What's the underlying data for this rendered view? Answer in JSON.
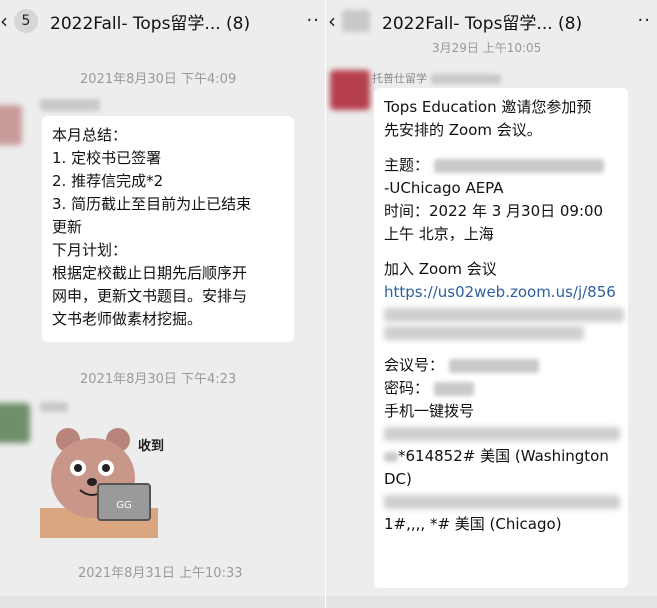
{
  "left": {
    "header": {
      "badge": "5",
      "title": "2022Fall-    Tops留学... (8)",
      "more": "··"
    },
    "messages": [
      {
        "timestamp": "2021年8月30日 下午4:09",
        "lines": [
          "本月总结：",
          "1. 定校书已签署",
          "2. 推荐信完成*2",
          "3. 简历截止至目前为止已结束",
          "更新",
          "下月计划：",
          "根据定校截止日期先后顺序开",
          "网申，更新文书题目。安排与",
          "文书老师做素材挖掘。"
        ]
      },
      {
        "timestamp": "2021年8月30日 下午4:23",
        "sticker_text": "收到"
      },
      {
        "timestamp": "2021年8月31日 上午10:33"
      }
    ]
  },
  "right": {
    "header": {
      "title": "2022Fall-    Tops留学... (8)",
      "more": "··"
    },
    "top_timestamp": "3月29日 上午10:05",
    "sender": "托普仕留学",
    "lines": {
      "l1": "Tops Education 邀请您参加预",
      "l2": "先安排的 Zoom 会议。",
      "l3": "主题：",
      "l4": "-UChicago AEPA",
      "l5": "时间：2022 年 3 月30日 09:00",
      "l6": "上午 北京，上海",
      "l7": "加入 Zoom 会议",
      "l8": "https://us02web.zoom.us/j/856",
      "l9": "会议号：",
      "l10": "密码：",
      "l11": "手机一键拨号",
      "l12": "*614852# 美国 (Washington",
      "l13": "DC)",
      "l14": "1#,,,,     *# 美国 (Chicago)"
    }
  },
  "colors": {
    "background": "#ededed",
    "bubble": "#ffffff",
    "link": "#2e5f9e",
    "timestamp": "#9a9a9a"
  }
}
